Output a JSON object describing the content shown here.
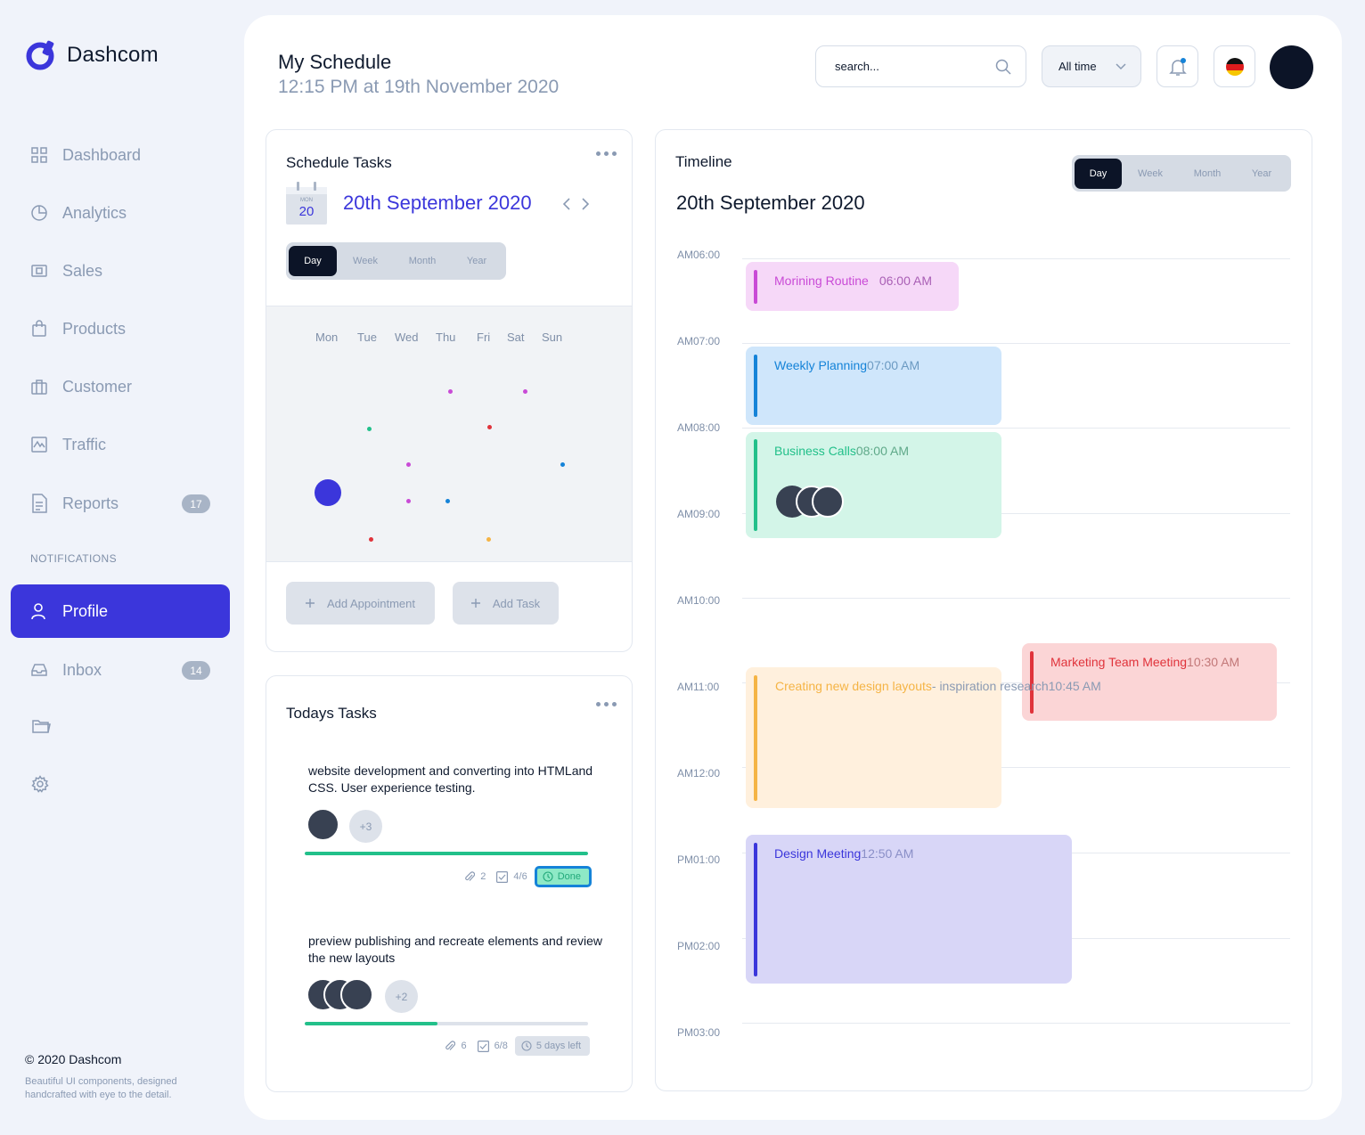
{
  "brand": {
    "name": "Dashcom"
  },
  "sidebar": {
    "items": [
      {
        "label": "Dashboard"
      },
      {
        "label": "Analytics"
      },
      {
        "label": "Sales"
      },
      {
        "label": "Products"
      },
      {
        "label": "Customer"
      },
      {
        "label": "Traffic"
      },
      {
        "label": "Reports",
        "badge": "17"
      }
    ],
    "section_label": "NOTIFICATIONS",
    "active": {
      "label": "Profile"
    },
    "inbox": {
      "label": "Inbox",
      "badge": "14"
    }
  },
  "footer": {
    "title": "© 2020 Dashcom",
    "description": "Beautiful UI components, designed handcrafted with eye to the detail."
  },
  "header": {
    "title": "My Schedule",
    "subtitle": "12:15 PM at 19th November 2020",
    "search_placeholder": "search...",
    "filter_label": "All time"
  },
  "schedule_tasks": {
    "title": "Schedule Tasks",
    "calendar_icon_month": "MON",
    "calendar_icon_day": "20",
    "date": "20th September 2020",
    "views": [
      "Day",
      "Week",
      "Month",
      "Year"
    ],
    "weekdays": [
      "Mon",
      "Tue",
      "Wed",
      "Thu",
      "Fri",
      "Sat",
      "Sun"
    ],
    "add_appointment": "Add Appointment",
    "add_task": "Add Task"
  },
  "todays_tasks": {
    "title": "Todays Tasks",
    "tasks": [
      {
        "text": "website development and converting into HTMLand CSS. User experience testing.",
        "more": "+3",
        "progress": 1.0,
        "attachments": "2",
        "checklist": "4/6",
        "status": "Done"
      },
      {
        "text": "preview publishing and recreate elements and review the new layouts",
        "more": "+2",
        "progress": 0.47,
        "attachments": "6",
        "checklist": "6/8",
        "status": "5 days left"
      }
    ]
  },
  "timeline": {
    "title": "Timeline",
    "date": "20th September 2020",
    "views": [
      "Day",
      "Week",
      "Month",
      "Year"
    ],
    "hours": [
      "AM06:00",
      "AM07:00",
      "AM08:00",
      "AM09:00",
      "AM10:00",
      "AM11:00",
      "AM12:00",
      "PM01:00",
      "PM02:00",
      "PM03:00"
    ],
    "events": [
      {
        "name": "Morining Routine",
        "time": "06:00 AM",
        "color": "#c94ad6"
      },
      {
        "name": "Weekly Planning",
        "time": "07:00 AM",
        "color": "#1583d8"
      },
      {
        "name": "Business Calls",
        "time": "08:00 AM",
        "color": "#22c08a"
      },
      {
        "name": "Creating new design layouts",
        "name_suffix": "- inspiration research",
        "time": "10:45 AM",
        "color": "#f5b445"
      },
      {
        "name": "Marketing Team Meeting",
        "time": "10:30 AM",
        "color": "#e0333b"
      },
      {
        "name": "Design Meeting",
        "time": "12:50 AM",
        "color": "#3b36db"
      }
    ]
  },
  "colors": {
    "accent": "#3b36db",
    "dark": "#0c1427",
    "muted": "#8a9ab3"
  }
}
